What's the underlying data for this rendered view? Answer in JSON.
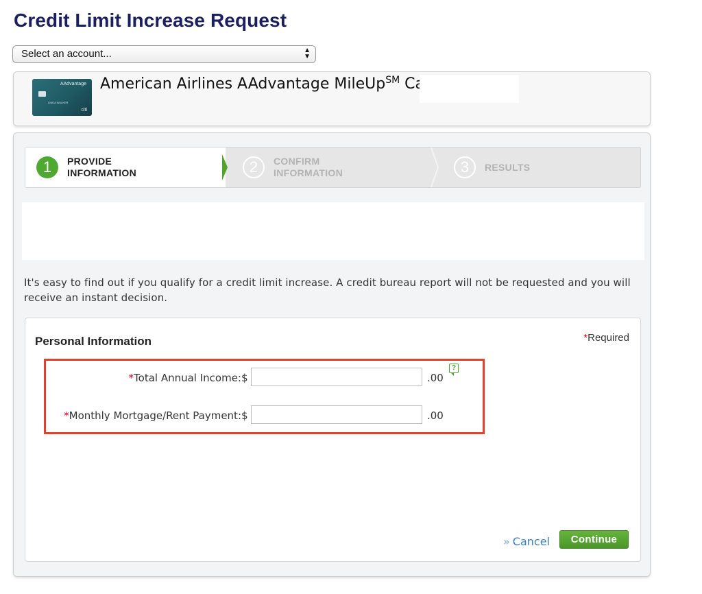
{
  "page_title": "Credit Limit Increase Request",
  "account_select": {
    "value": "Select an account..."
  },
  "card": {
    "name": "American Airlines AAdvantage MileUp",
    "name_sup": "SM",
    "name_suffix": " Card",
    "image_brand": "AAdvantage",
    "image_holder": "LINDA WALKER",
    "image_logo": "citi"
  },
  "stepper": {
    "steps": [
      {
        "number": "1",
        "label": "PROVIDE INFORMATION",
        "state": "active"
      },
      {
        "number": "2",
        "label": "CONFIRM INFORMATION",
        "state": "inactive"
      },
      {
        "number": "3",
        "label": "RESULTS",
        "state": "inactive"
      }
    ]
  },
  "intro_text": "It's easy to find out if you qualify for a credit limit increase. A credit bureau report will not be requested and you will receive an instant decision.",
  "form": {
    "heading": "Personal Information",
    "required_mark": "*",
    "required_note": "Required",
    "fields": [
      {
        "label": "Total Annual Income:",
        "currency": "$",
        "value": "",
        "cents": ".00",
        "help_icon": "help-icon"
      },
      {
        "label": "Monthly Mortgage/Rent Payment:",
        "currency": "$",
        "value": "",
        "cents": ".00"
      }
    ],
    "help_icon_glyph": "?",
    "cancel_prefix": "»",
    "cancel_label": "Cancel",
    "continue_label": "Continue"
  },
  "colors": {
    "title": "#1b1f5e",
    "step_active": "#4fa832",
    "highlight": "#e2412c",
    "link": "#3b7fbf",
    "continue": "#55a22d"
  }
}
